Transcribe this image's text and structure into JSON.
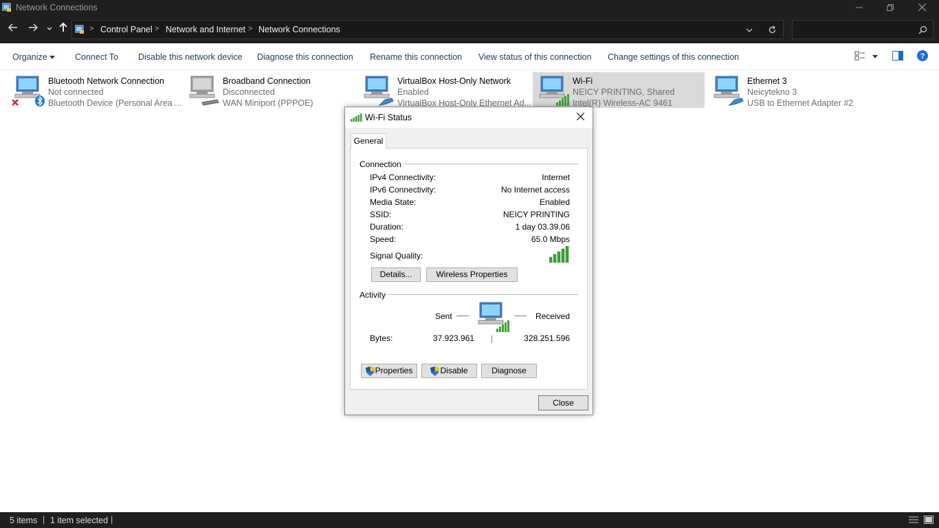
{
  "window": {
    "title": "Network Connections"
  },
  "address": {
    "crumbs": [
      "Control Panel",
      "Network and Internet",
      "Network Connections"
    ],
    "search_placeholder": ""
  },
  "toolbar": {
    "organize": "Organize",
    "connect_to": "Connect To",
    "disable_device": "Disable this network device",
    "diagnose": "Diagnose this connection",
    "rename": "Rename this connection",
    "view_status": "View status of this connection",
    "change_settings": "Change settings of this connection"
  },
  "connections": [
    {
      "name": "Bluetooth Network Connection",
      "status": "Not connected",
      "device": "Bluetooth Device (Personal Area ...",
      "icon": "bluetooth-network-icon"
    },
    {
      "name": "Broadband Connection",
      "status": "Disconnected",
      "device": "WAN Miniport (PPPOE)",
      "icon": "broadband-modem-icon"
    },
    {
      "name": "VirtualBox Host-Only Network",
      "status": "Enabled",
      "device": "VirtualBox Host-Only Ethernet Ad...",
      "icon": "ethernet-network-icon"
    },
    {
      "name": "Wi-Fi",
      "status": "NEICY PRINTING, Shared",
      "device": "Intel(R) Wireless-AC 9461",
      "icon": "wifi-network-icon"
    },
    {
      "name": "Ethernet 3",
      "status": "Neicytekno 3",
      "device": "USB to Ethernet Adapter #2",
      "icon": "ethernet-network-icon"
    }
  ],
  "statusbar": {
    "items": "5 items",
    "selected": "1 item selected"
  },
  "dialog": {
    "title": "Wi-Fi Status",
    "tab": "General",
    "connection_label": "Connection",
    "rows": [
      {
        "label": "IPv4 Connectivity:",
        "value": "Internet"
      },
      {
        "label": "IPv6 Connectivity:",
        "value": "No Internet access"
      },
      {
        "label": "Media State:",
        "value": "Enabled"
      },
      {
        "label": "SSID:",
        "value": "NEICY PRINTING"
      },
      {
        "label": "Duration:",
        "value": "1 day 03.39.06"
      },
      {
        "label": "Speed:",
        "value": "65.0 Mbps"
      }
    ],
    "signal_label": "Signal Quality:",
    "signal_bars": 5,
    "details_button": "Details...",
    "wireless_button": "Wireless Properties",
    "activity_label": "Activity",
    "sent_label": "Sent",
    "received_label": "Received",
    "bytes_label": "Bytes:",
    "bytes_sent": "37.923.961",
    "bytes_received": "328.251.596",
    "properties_button": "Properties",
    "disable_button": "Disable",
    "diagnose_button": "Diagnose",
    "close_button": "Close"
  },
  "colors": {
    "link": "#1e395b",
    "selected": "#d9d9d9",
    "signal": "#3aa335",
    "dark": "#1f1f1f"
  }
}
